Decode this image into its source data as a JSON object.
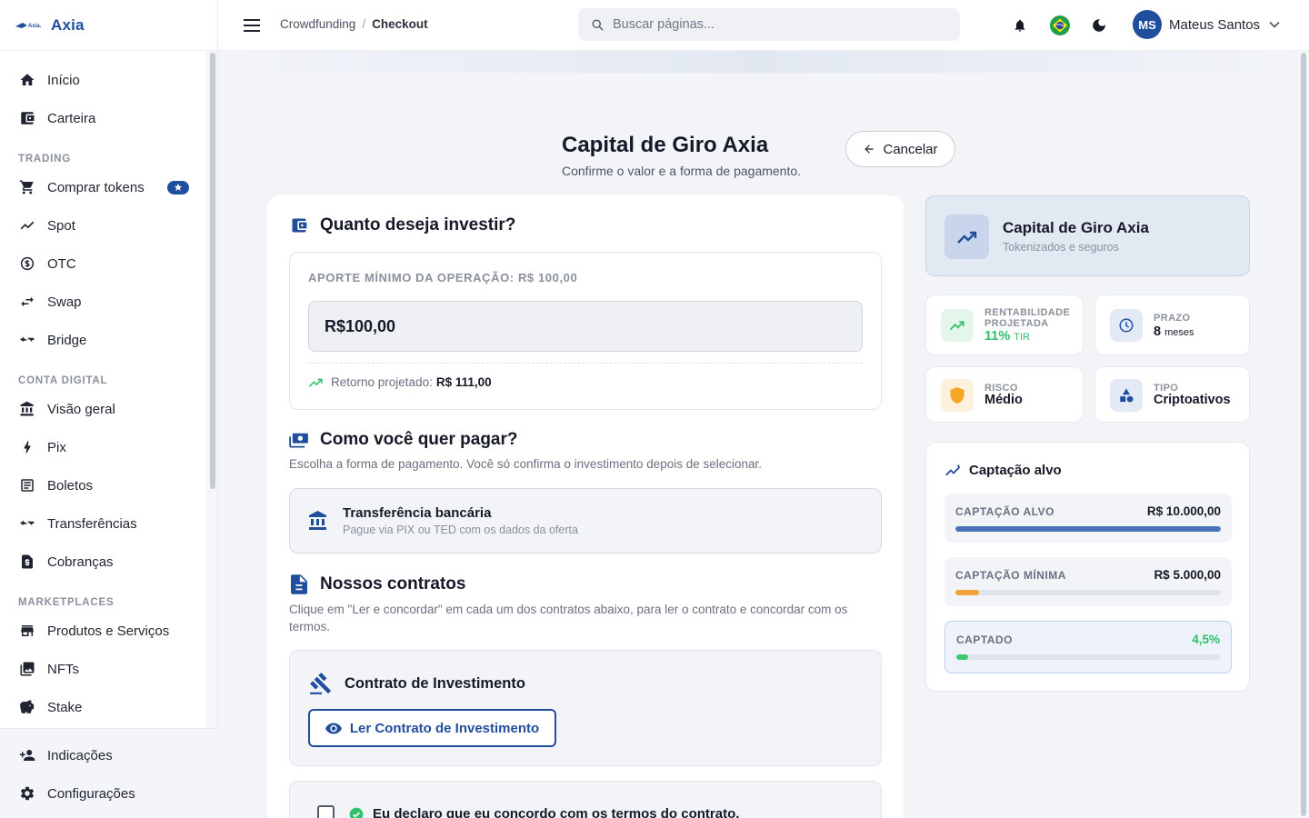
{
  "app": {
    "name": "Axia",
    "logo_text": "Axia."
  },
  "sidebar": {
    "top_items": [
      {
        "label": "Início",
        "icon": "home-icon"
      },
      {
        "label": "Carteira",
        "icon": "wallet-icon"
      }
    ],
    "sections": [
      {
        "title": "TRADING",
        "items": [
          {
            "label": "Comprar tokens",
            "icon": "cart-icon",
            "badge": "star"
          },
          {
            "label": "Spot",
            "icon": "trend-icon"
          },
          {
            "label": "OTC",
            "icon": "currency-exchange-icon"
          },
          {
            "label": "Swap",
            "icon": "swap-icon"
          },
          {
            "label": "Bridge",
            "icon": "bridge-icon"
          }
        ]
      },
      {
        "title": "CONTA DIGITAL",
        "items": [
          {
            "label": "Visão geral",
            "icon": "bank-icon"
          },
          {
            "label": "Pix",
            "icon": "bolt-icon"
          },
          {
            "label": "Boletos",
            "icon": "receipt-icon"
          },
          {
            "label": "Transferências",
            "icon": "transfer-icon"
          },
          {
            "label": "Cobranças",
            "icon": "invoice-icon"
          }
        ]
      },
      {
        "title": "MARKETPLACES",
        "items": [
          {
            "label": "Produtos e Serviços",
            "icon": "store-icon"
          },
          {
            "label": "NFTs",
            "icon": "image-icon"
          },
          {
            "label": "Stake",
            "icon": "piggy-bank-icon"
          }
        ]
      }
    ],
    "bottom_items": [
      {
        "label": "Indicações",
        "icon": "referral-icon"
      },
      {
        "label": "Configurações",
        "icon": "gear-icon"
      }
    ]
  },
  "topbar": {
    "breadcrumb": [
      "Crowdfunding",
      "Checkout"
    ],
    "search_placeholder": "Buscar páginas...",
    "user": {
      "initials": "MS",
      "name": "Mateus Santos"
    }
  },
  "page": {
    "title": "Capital de Giro Axia",
    "subtitle": "Confirme o valor e a forma de pagamento.",
    "cancel_label": "Cancelar"
  },
  "invest": {
    "heading": "Quanto deseja investir?",
    "min_label": "APORTE MÍNIMO DA OPERAÇÃO: R$ 100,00",
    "amount": "R$100,00",
    "projected_label": "Retorno projetado:",
    "projected_value": "R$ 111,00"
  },
  "payment": {
    "heading": "Como você quer pagar?",
    "description": "Escolha a forma de pagamento. Você só confirma o investimento depois de selecionar.",
    "option_title": "Transferência bancária",
    "option_subtitle": "Pague via PIX ou TED com os dados da oferta"
  },
  "contracts": {
    "heading": "Nossos contratos",
    "description": "Clique em \"Ler e concordar\" em cada um dos contratos abaixo, para ler o contrato e concordar com os termos.",
    "contract_title": "Contrato de Investimento",
    "read_button": "Ler Contrato de Investimento",
    "agree_text": "Eu declaro que eu concordo com os termos do contrato."
  },
  "offer": {
    "title": "Capital de Giro Axia",
    "subtitle": "Tokenizados e seguros",
    "stats": {
      "rent_label_1": "RENTABILIDADE",
      "rent_label_2": "PROJETADA",
      "rent_value": "11%",
      "rent_unit": "TIR",
      "prazo_label": "PRAZO",
      "prazo_value": "8",
      "prazo_unit": "meses",
      "risco_label": "RISCO",
      "risco_value": "Médio",
      "tipo_label": "TIPO",
      "tipo_value": "Criptoativos"
    }
  },
  "goals": {
    "heading": "Captação alvo",
    "items": [
      {
        "label": "CAPTAÇÃO ALVO",
        "value": "R$ 10.000,00",
        "progress": 1.0,
        "color": "#4a72b8"
      },
      {
        "label": "CAPTAÇÃO MÍNIMA",
        "value": "R$ 5.000,00",
        "progress": 0.09,
        "color": "#f0a43a"
      },
      {
        "label": "CAPTADO",
        "value": "4,5%",
        "progress": 0.045,
        "color": "#3cc872"
      }
    ]
  },
  "colors": {
    "brand": "#1f4e9c",
    "success": "#2fbf6b",
    "warning": "#f5a623"
  }
}
